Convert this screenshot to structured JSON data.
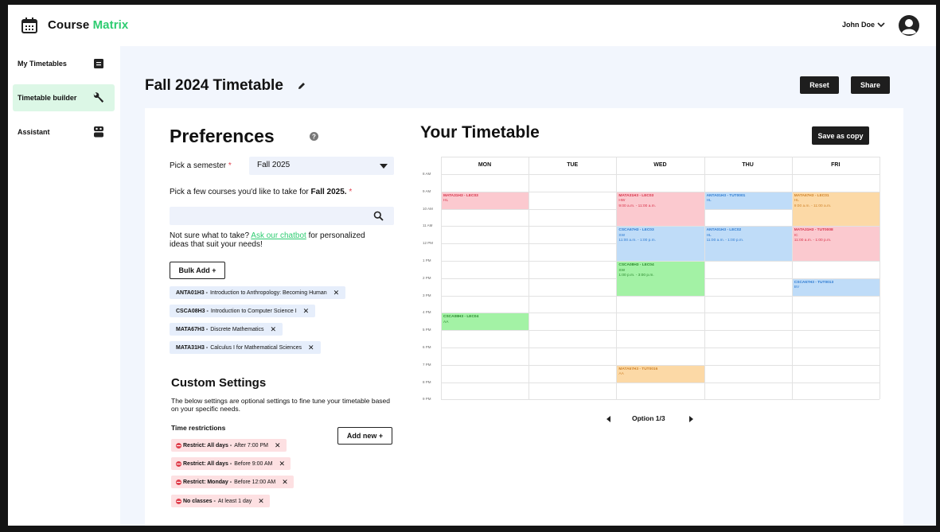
{
  "app": {
    "name_part1": "Course",
    "name_part2": "Matrix",
    "accent": "#2ecc71"
  },
  "user": {
    "name": "John Doe"
  },
  "sidebar": {
    "items": [
      {
        "label": "My Timetables",
        "icon": "timetable-icon"
      },
      {
        "label": "Timetable builder",
        "icon": "wrench-icon",
        "active": true
      },
      {
        "label": "Assistant",
        "icon": "robot-icon"
      }
    ]
  },
  "page": {
    "title": "Fall 2024 Timetable",
    "reset_label": "Reset",
    "share_label": "Share"
  },
  "preferences": {
    "title": "Preferences",
    "semester_label": "Pick a semester",
    "semester_value": "Fall 2025",
    "courses_prompt_pre": "Pick a few courses you'd like to take for",
    "courses_prompt_term": "Fall 2025.",
    "hint_pre": "Not sure what to take?",
    "hint_link": "Ask our chatbot",
    "hint_post": "for personalized ideas that suit your needs!",
    "bulk_add_label": "Bulk Add +",
    "courses": [
      {
        "code": "ANTA01H3 -",
        "name": "Introduction to Anthropology: Becoming Human"
      },
      {
        "code": "CSCA08H3 -",
        "name": "Introduction to Computer Science I"
      },
      {
        "code": "MATA67H3 -",
        "name": "Discrete Mathematics"
      },
      {
        "code": "MATA31H3 -",
        "name": "Calculus I for Mathematical Sciences"
      }
    ]
  },
  "custom_settings": {
    "title": "Custom Settings",
    "description": "The below settings are optional settings to fine tune your timetable based on your specific needs.",
    "time_restrictions_label": "Time restrictions",
    "add_new_label": "Add new +",
    "restrictions": [
      {
        "bold": "Restrict: All days -",
        "detail": "After 7:00 PM"
      },
      {
        "bold": "Restrict: All days -",
        "detail": "Before 9:00 AM"
      },
      {
        "bold": "Restrict: Monday -",
        "detail": "Before 12:00 AM"
      },
      {
        "bold": "No classes -",
        "detail": "At least 1 day"
      }
    ]
  },
  "timetable": {
    "title": "Your Timetable",
    "save_copy_label": "Save as copy",
    "days": [
      "MON",
      "TUE",
      "WED",
      "THU",
      "FRI"
    ],
    "times": [
      "8 AM",
      "9 AM",
      "10 AM",
      "11 AM",
      "12 PM",
      "1 PM",
      "2 PM",
      "3 PM",
      "4 PM",
      "5 PM",
      "6 PM",
      "7 PM",
      "8 PM",
      "9 PM"
    ],
    "events": [
      {
        "day": 0,
        "start": 9,
        "end": 10,
        "code": "MATA31H3 - LEC03",
        "room": "HL",
        "time": "",
        "color": "red"
      },
      {
        "day": 2,
        "start": 9,
        "end": 11,
        "code": "MATA31H3 - LEC03",
        "room": "HW",
        "time": "9:00 a.m. - 11:00 a.m.",
        "color": "red"
      },
      {
        "day": 3,
        "start": 9,
        "end": 10,
        "code": "ANTA01H3 - TUT0001",
        "room": "HL",
        "time": "",
        "color": "blue"
      },
      {
        "day": 4,
        "start": 9,
        "end": 11,
        "code": "MATA67H3 - LEC01",
        "room": "HL",
        "time": "9:00 a.m. - 11:00 a.m.",
        "color": "orange"
      },
      {
        "day": 2,
        "start": 11,
        "end": 13,
        "code": "CSCA67H3 - LEC03",
        "room": "SW",
        "time": "11:00 a.m. - 1:00 p.m.",
        "color": "blue"
      },
      {
        "day": 3,
        "start": 11,
        "end": 13,
        "code": "ANTA01H3 - LEC02",
        "room": "HL",
        "time": "11:00 a.m. - 1:00 p.m.",
        "color": "blue"
      },
      {
        "day": 4,
        "start": 11,
        "end": 13,
        "code": "MATA31H3 - TUT0008",
        "room": "IC",
        "time": "11:00 a.m. - 1:00 p.m.",
        "color": "red"
      },
      {
        "day": 2,
        "start": 13,
        "end": 15,
        "code": "CSCA08H3 - LEC04",
        "room": "SW",
        "time": "1:00 p.m. - 3:00 p.m.",
        "color": "green"
      },
      {
        "day": 4,
        "start": 14,
        "end": 15,
        "code": "CSCA67H3 - TUT0013",
        "room": "BV",
        "time": "",
        "color": "blue"
      },
      {
        "day": 0,
        "start": 16,
        "end": 17,
        "code": "CSCA08H3 - LEC04",
        "room": "AA",
        "time": "",
        "color": "green"
      },
      {
        "day": 2,
        "start": 19,
        "end": 20,
        "code": "MATA67H3 - TUT0016",
        "room": "AA",
        "time": "",
        "color": "orange"
      }
    ],
    "option_label": "Option 1/3"
  }
}
